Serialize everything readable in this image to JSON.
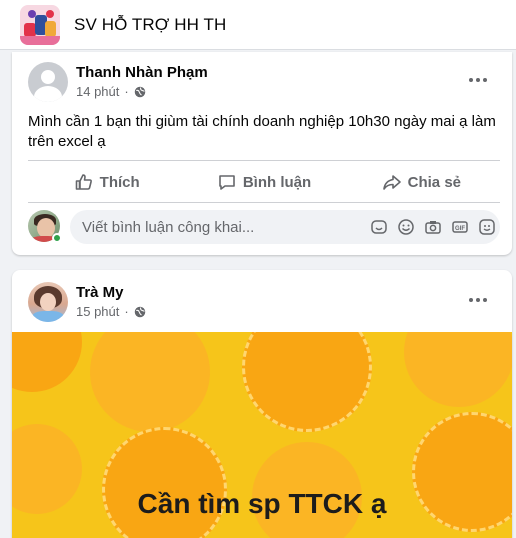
{
  "group": {
    "name": "SV HỖ TRỢ HH TH"
  },
  "posts": [
    {
      "author": "Thanh Nhàn Phạm",
      "time": "14 phút",
      "text": "Mình cần 1 bạn thi giùm tài chính doanh nghiệp 10h30 ngày mai ạ làm trên excel ạ",
      "actions": {
        "like": "Thích",
        "comment": "Bình luận",
        "share": "Chia sẻ"
      },
      "comment_placeholder": "Viết bình luận công khai..."
    },
    {
      "author": "Trà My",
      "time": "15 phút",
      "image_text": "Cần tìm sp TTCK ạ",
      "image_bg": "#f6c51a"
    }
  ],
  "colors": {
    "background": "#f0f2f5",
    "card": "#ffffff",
    "secondary_text": "#65676b",
    "online": "#31a24c"
  },
  "icons": [
    "group-avatar",
    "globe-icon",
    "more-icon",
    "like-icon",
    "comment-icon",
    "share-icon",
    "sticker-icon",
    "emoji-icon",
    "camera-icon",
    "gif-icon",
    "avatar-sticker-icon"
  ]
}
